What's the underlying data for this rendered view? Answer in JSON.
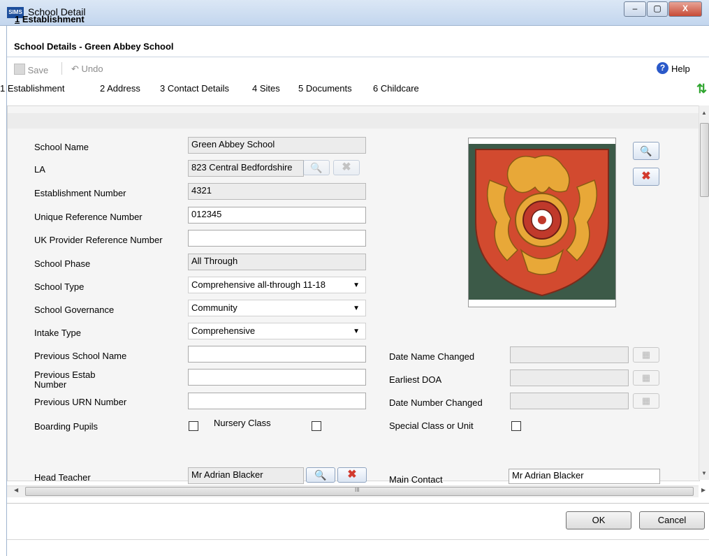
{
  "window": {
    "app_logo": "SIMS",
    "title": "School Detail",
    "controls": {
      "minimize": "–",
      "maximize": "▢",
      "close": "X"
    }
  },
  "page_title": "School Details - Green Abbey School",
  "toolbar": {
    "save_label": "Save",
    "undo_label": "Undo",
    "help_label": "Help"
  },
  "tabs": [
    "1 Establishment",
    "2 Address",
    "3 Contact Details",
    "4 Sites",
    "5 Documents",
    "6 Childcare"
  ],
  "section": {
    "number": "1",
    "title": " Establishment"
  },
  "fields": {
    "school_name": {
      "label": "School Name",
      "value": "Green Abbey School"
    },
    "la": {
      "label": "LA",
      "value": "823 Central Bedfordshire"
    },
    "establishment_number": {
      "label": "Establishment Number",
      "value": "4321"
    },
    "urn": {
      "label": "Unique Reference Number",
      "value": "012345"
    },
    "ukprn": {
      "label": "UK Provider Reference Number",
      "value": ""
    },
    "school_phase": {
      "label": "School Phase",
      "value": "All Through"
    },
    "school_type": {
      "label": "School Type",
      "value": "Comprehensive all-through 11-18"
    },
    "school_governance": {
      "label": "School Governance",
      "value": "Community"
    },
    "intake_type": {
      "label": "Intake Type",
      "value": "Comprehensive"
    },
    "previous_school_name": {
      "label": "Previous School Name",
      "value": ""
    },
    "previous_estab_number": {
      "label_line1": "Previous Estab",
      "label_line2": "Number",
      "value": ""
    },
    "previous_urn": {
      "label": "Previous URN Number",
      "value": ""
    },
    "date_name_changed": {
      "label": "Date Name Changed",
      "value": ""
    },
    "earliest_doa": {
      "label": "Earliest DOA",
      "value": ""
    },
    "date_number_changed": {
      "label": "Date Number Changed",
      "value": ""
    },
    "boarding_pupils": {
      "label": "Boarding Pupils",
      "checked": false
    },
    "nursery_class": {
      "label": "Nursery Class",
      "checked": false
    },
    "special_class": {
      "label": "Special Class or Unit",
      "checked": false
    },
    "head_teacher": {
      "label": "Head Teacher",
      "value": "Mr Adrian Blacker"
    },
    "main_contact": {
      "label": "Main Contact",
      "value": "Mr Adrian Blacker"
    }
  },
  "footer": {
    "ok_label": "OK",
    "cancel_label": "Cancel"
  },
  "hscroll_grip": "III",
  "colors": {
    "crest_red": "#d24a2f",
    "crest_gold": "#e8a838",
    "crest_bg": "#3c5a48",
    "accent": "#2a59c9"
  }
}
